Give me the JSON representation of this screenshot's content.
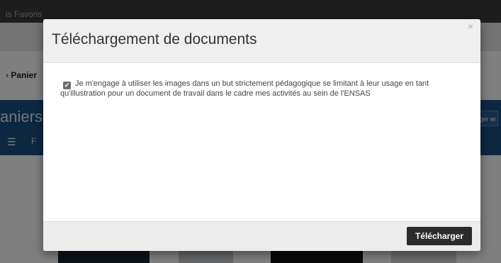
{
  "background": {
    "menu_text": "is Favoris",
    "breadcrumb_arrow": "›",
    "breadcrumb_label": "Panier",
    "section_title": "aniers",
    "list_icon_glyph": "☰",
    "filter_letter": "F",
    "right_button_label": "ger er"
  },
  "modal": {
    "title": "Téléchargement de documents",
    "close_glyph": "×",
    "consent_text": "Je m'engage à utiliser les images dans un but strictement pédagogique se limitant à leur usage en tant qu'illustration pour un document de travail dans le cadre mes activités au sein de l'ENSAS",
    "checkbox_checked": true,
    "checkbox_glyph": "✔",
    "download_button_label": "Télécharger"
  }
}
